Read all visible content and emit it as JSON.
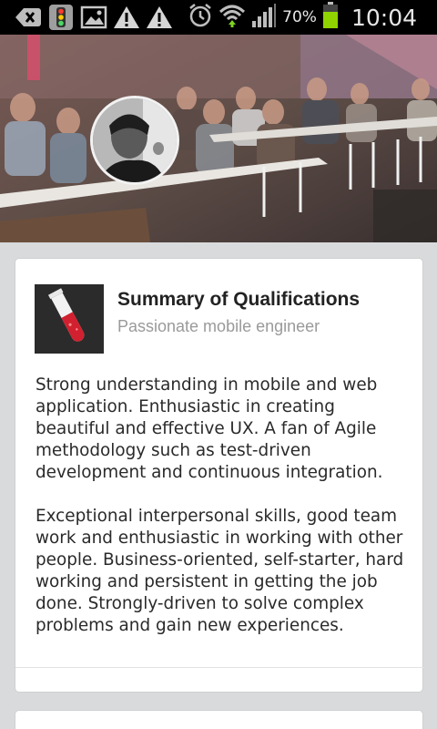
{
  "status_bar": {
    "icons_left": [
      "back-notification-icon",
      "traffic-light-icon",
      "image-icon",
      "warning-icon",
      "warning-icon"
    ],
    "icons_right": [
      "alarm-icon",
      "wifi-icon",
      "signal-icon",
      "battery-icon"
    ],
    "battery_percent": "70%",
    "time": "10:04",
    "battery_color": "#8fd400"
  },
  "profile": {
    "cover": "conference-room-photo",
    "avatar": "profile-avatar"
  },
  "summary_card": {
    "icon": "test-tube-icon",
    "title": "Summary of Qualifications",
    "subtitle": "Passionate mobile engineer",
    "paragraphs": [
      "Strong understanding in mobile and web application. Enthusiastic in creating beautiful and effective UX. A fan of Agile methodology such as test-driven development and continuous integration.",
      "Exceptional interpersonal skills, good team work and enthusiastic in working with other people. Business-oriented, self-starter, hard working and persistent in getting the job done. Strongly-driven to solve complex problems and gain new experiences."
    ]
  }
}
